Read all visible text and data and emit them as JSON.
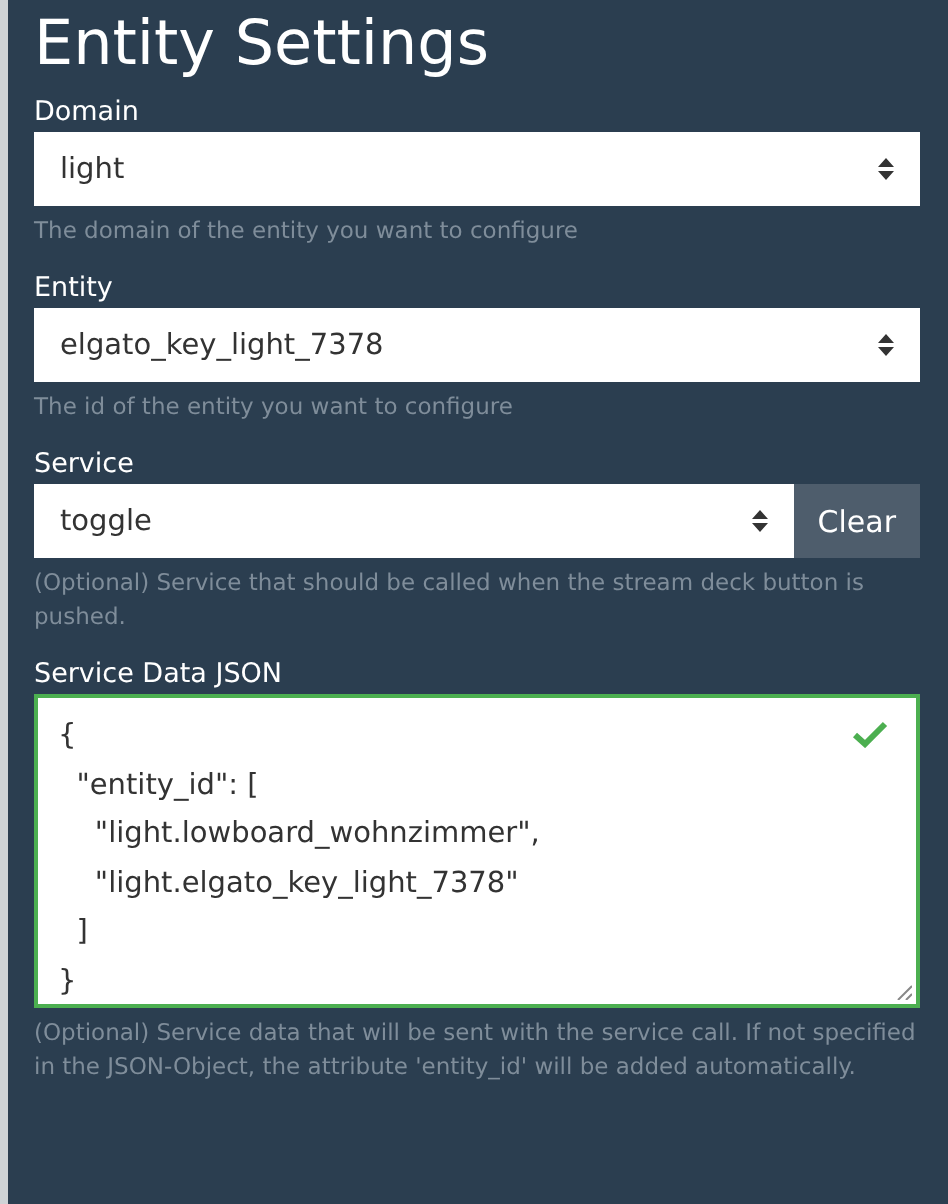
{
  "title": "Entity Settings",
  "fields": [
    {
      "kind": "select",
      "label": "Domain",
      "value": "light",
      "help": "The domain of the entity you want to configure"
    },
    {
      "kind": "select",
      "label": "Entity",
      "value": "elgato_key_light_7378",
      "help": "The id of the entity you want to configure"
    },
    {
      "kind": "select",
      "label": "Service",
      "value": "toggle",
      "button": "Clear",
      "help": "(Optional) Service that should be called when the stream deck button is pushed."
    },
    {
      "kind": "textarea",
      "label": "Service Data JSON",
      "value": "{\n  \"entity_id\": [\n    \"light.lowboard_wohnzimmer\",\n    \"light.elgato_key_light_7378\"\n  ]\n}",
      "valid": true,
      "help": "(Optional) Service data that will be sent with the service call. If not specified in the JSON-Object, the attribute 'entity_id' will be added automatically."
    }
  ]
}
